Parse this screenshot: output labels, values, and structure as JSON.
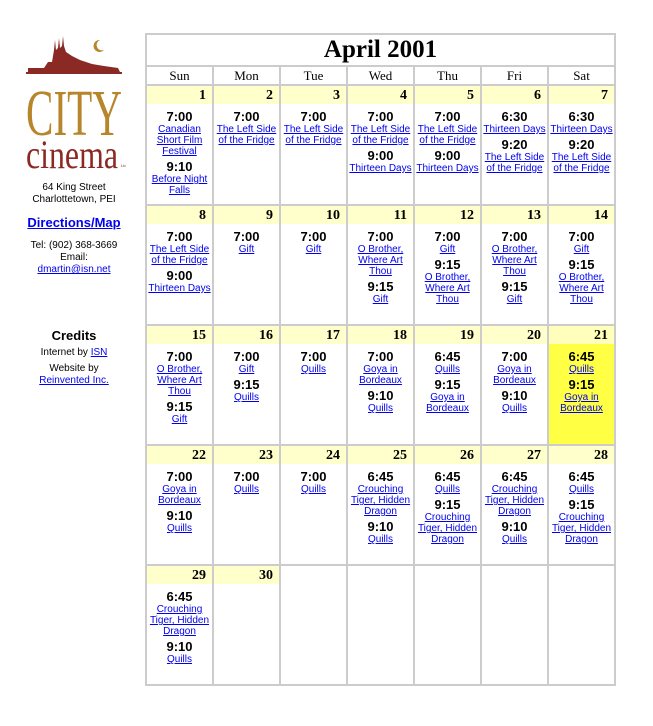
{
  "sidebar": {
    "logo_alt": "City Cinema Ltd. logo",
    "address_line1": "64 King Street",
    "address_line2": "Charlottetown, PEI",
    "directions_label": "Directions/Map",
    "tel": "Tel: (902) 368-3669",
    "email_label": "Email:",
    "email": "dmartin@isn.net",
    "credits_title": "Credits",
    "internet_by_label": "Internet by",
    "internet_by_link": "ISN",
    "website_by_label": "Website by",
    "website_by_link": "Reinvented Inc."
  },
  "colors": {
    "logo_red": "#8b2a24",
    "logo_gold": "#b8862a",
    "daynum_bg": "#ffffcc",
    "today_bg": "#ffff44",
    "grid": "#cccccc",
    "link": "#0000ee"
  },
  "calendar": {
    "title": "April 2001",
    "weekdays": [
      "Sun",
      "Mon",
      "Tue",
      "Wed",
      "Thu",
      "Fri",
      "Sat"
    ],
    "highlighted_day": "21",
    "weeks": [
      [
        {
          "day": "1",
          "shows": [
            {
              "time": "7:00",
              "film": "Canadian Short Film Festival"
            },
            {
              "time": "9:10",
              "film": "Before Night Falls"
            }
          ]
        },
        {
          "day": "2",
          "shows": [
            {
              "time": "7:00",
              "film": "The Left Side of the Fridge"
            }
          ]
        },
        {
          "day": "3",
          "shows": [
            {
              "time": "7:00",
              "film": "The Left Side of the Fridge"
            }
          ]
        },
        {
          "day": "4",
          "shows": [
            {
              "time": "7:00",
              "film": "The Left Side of the Fridge"
            },
            {
              "time": "9:00",
              "film": "Thirteen Days"
            }
          ]
        },
        {
          "day": "5",
          "shows": [
            {
              "time": "7:00",
              "film": "The Left Side of the Fridge"
            },
            {
              "time": "9:00",
              "film": "Thirteen Days"
            }
          ]
        },
        {
          "day": "6",
          "shows": [
            {
              "time": "6:30",
              "film": "Thirteen Days"
            },
            {
              "time": "9:20",
              "film": "The Left Side of the Fridge"
            }
          ]
        },
        {
          "day": "7",
          "shows": [
            {
              "time": "6:30",
              "film": "Thirteen Days"
            },
            {
              "time": "9:20",
              "film": "The Left Side of the Fridge"
            }
          ]
        }
      ],
      [
        {
          "day": "8",
          "shows": [
            {
              "time": "7:00",
              "film": "The Left Side of the Fridge"
            },
            {
              "time": "9:00",
              "film": "Thirteen Days"
            }
          ]
        },
        {
          "day": "9",
          "shows": [
            {
              "time": "7:00",
              "film": "Gift"
            }
          ]
        },
        {
          "day": "10",
          "shows": [
            {
              "time": "7:00",
              "film": "Gift"
            }
          ]
        },
        {
          "day": "11",
          "shows": [
            {
              "time": "7:00",
              "film": "O Brother, Where Art Thou"
            },
            {
              "time": "9:15",
              "film": "Gift"
            }
          ]
        },
        {
          "day": "12",
          "shows": [
            {
              "time": "7:00",
              "film": "Gift"
            },
            {
              "time": "9:15",
              "film": "O Brother, Where Art Thou"
            }
          ]
        },
        {
          "day": "13",
          "shows": [
            {
              "time": "7:00",
              "film": "O Brother, Where Art Thou"
            },
            {
              "time": "9:15",
              "film": "Gift"
            }
          ]
        },
        {
          "day": "14",
          "shows": [
            {
              "time": "7:00",
              "film": "Gift"
            },
            {
              "time": "9:15",
              "film": "O Brother, Where Art Thou"
            }
          ]
        }
      ],
      [
        {
          "day": "15",
          "shows": [
            {
              "time": "7:00",
              "film": "O Brother, Where Art Thou"
            },
            {
              "time": "9:15",
              "film": "Gift"
            }
          ]
        },
        {
          "day": "16",
          "shows": [
            {
              "time": "7:00",
              "film": "Gift"
            },
            {
              "time": "9:15",
              "film": "Quills"
            }
          ]
        },
        {
          "day": "17",
          "shows": [
            {
              "time": "7:00",
              "film": "Quills"
            }
          ]
        },
        {
          "day": "18",
          "shows": [
            {
              "time": "7:00",
              "film": "Goya in Bordeaux"
            },
            {
              "time": "9:10",
              "film": "Quills"
            }
          ]
        },
        {
          "day": "19",
          "shows": [
            {
              "time": "6:45",
              "film": "Quills"
            },
            {
              "time": "9:15",
              "film": "Goya in Bordeaux"
            }
          ]
        },
        {
          "day": "20",
          "shows": [
            {
              "time": "7:00",
              "film": "Goya in Bordeaux"
            },
            {
              "time": "9:10",
              "film": "Quills"
            }
          ]
        },
        {
          "day": "21",
          "shows": [
            {
              "time": "6:45",
              "film": "Quills"
            },
            {
              "time": "9:15",
              "film": "Goya in Bordeaux"
            }
          ]
        }
      ],
      [
        {
          "day": "22",
          "shows": [
            {
              "time": "7:00",
              "film": "Goya in Bordeaux"
            },
            {
              "time": "9:10",
              "film": "Quills"
            }
          ]
        },
        {
          "day": "23",
          "shows": [
            {
              "time": "7:00",
              "film": "Quills"
            }
          ]
        },
        {
          "day": "24",
          "shows": [
            {
              "time": "7:00",
              "film": "Quills"
            }
          ]
        },
        {
          "day": "25",
          "shows": [
            {
              "time": "6:45",
              "film": "Crouching Tiger, Hidden Dragon"
            },
            {
              "time": "9:10",
              "film": "Quills"
            }
          ]
        },
        {
          "day": "26",
          "shows": [
            {
              "time": "6:45",
              "film": "Quills"
            },
            {
              "time": "9:15",
              "film": "Crouching Tiger, Hidden Dragon"
            }
          ]
        },
        {
          "day": "27",
          "shows": [
            {
              "time": "6:45",
              "film": "Crouching Tiger, Hidden Dragon"
            },
            {
              "time": "9:10",
              "film": "Quills"
            }
          ]
        },
        {
          "day": "28",
          "shows": [
            {
              "time": "6:45",
              "film": "Quills"
            },
            {
              "time": "9:15",
              "film": "Crouching Tiger, Hidden Dragon"
            }
          ]
        }
      ],
      [
        {
          "day": "29",
          "shows": [
            {
              "time": "6:45",
              "film": "Crouching Tiger, Hidden Dragon"
            },
            {
              "time": "9:10",
              "film": "Quills"
            }
          ]
        },
        {
          "day": "30",
          "shows": []
        },
        null,
        null,
        null,
        null,
        null
      ]
    ]
  }
}
